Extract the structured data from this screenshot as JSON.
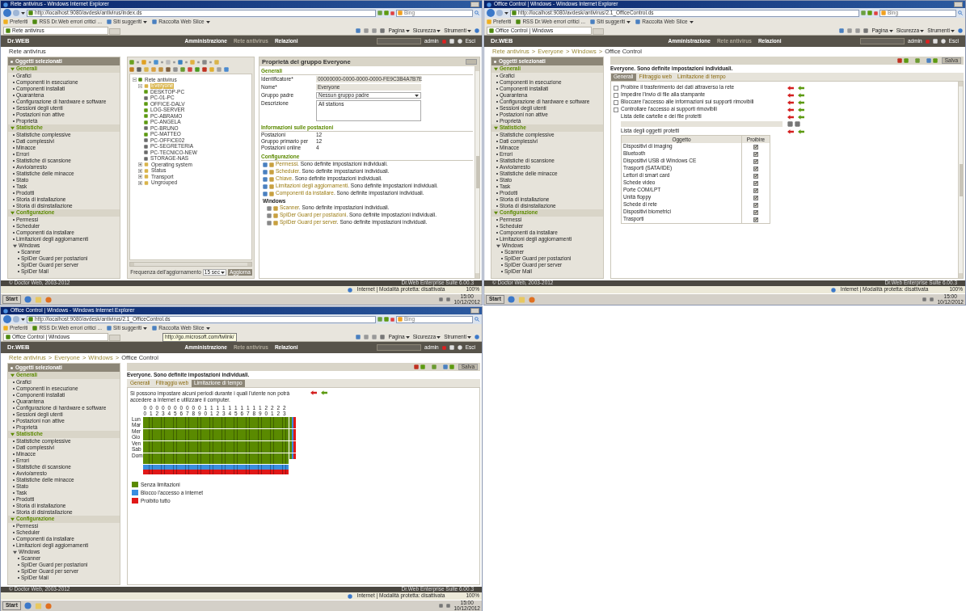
{
  "windows": [
    {
      "kind": "group_properties",
      "title": "Rete antivirus - Windows Internet Explorer",
      "url": "http://localhost:9080/avdesk/antivirus/index.ds",
      "search": "Bing",
      "favorites": [
        "Preferiti",
        "RSS Dr.Web errori critici ...",
        "Siti suggeriti",
        "Raccolta Web Slice"
      ],
      "tab": "Rete antivirus",
      "commands": [
        "Pagina",
        "Sicurezza",
        "Strumenti"
      ],
      "app": {
        "logo": "Dr.WEB",
        "nav": [
          {
            "label": "Amministrazione",
            "selected": false
          },
          {
            "label": "Rete antivirus",
            "selected": true
          },
          {
            "label": "Relazioni",
            "selected": false
          }
        ],
        "user": "admin",
        "logout": "Esci"
      },
      "breadcrumb": [
        "Rete antivirus"
      ],
      "sidebar": {
        "header": "Oggetti selezionati",
        "sections": [
          {
            "title": "Generali",
            "expanded": true,
            "items": [
              {
                "label": "Grafici"
              },
              {
                "label": "Componenti in esecuzione"
              },
              {
                "label": "Componenti installati"
              },
              {
                "label": "Quarantena"
              },
              {
                "label": "Configurazione di hardware e software"
              },
              {
                "label": "Sessioni degli utenti"
              },
              {
                "label": "Postazioni non attive"
              },
              {
                "label": "Proprietà"
              }
            ]
          },
          {
            "title": "Statistiche",
            "expanded": true,
            "items": [
              {
                "label": "Statistiche complessive"
              },
              {
                "label": "Dati complessivi"
              },
              {
                "label": "Minacce"
              },
              {
                "label": "Errori"
              },
              {
                "label": "Statistiche di scansione"
              },
              {
                "label": "Avvio/arresto"
              },
              {
                "label": "Statistiche delle minacce"
              },
              {
                "label": "Stato"
              },
              {
                "label": "Task"
              },
              {
                "label": "Prodotti"
              },
              {
                "label": "Storia di installazione"
              },
              {
                "label": "Storia di disinstallazione"
              }
            ]
          },
          {
            "title": "Configurazione",
            "expanded": true,
            "items": [
              {
                "label": "Permessi"
              },
              {
                "label": "Scheduler"
              },
              {
                "label": "Componenti da installare"
              },
              {
                "label": "Limitazioni degli aggiornamenti"
              },
              {
                "label": "Windows",
                "children": [
                  {
                    "label": "Scanner"
                  },
                  {
                    "label": "SpIDer Guard per postazioni"
                  },
                  {
                    "label": "SpIDer Guard per server"
                  },
                  {
                    "label": "SpIDer Mail"
                  }
                ]
              }
            ]
          }
        ]
      },
      "tree": {
        "nodes": [
          {
            "label": "Rete antivirus",
            "kind": "root",
            "expanded": true,
            "children": [
              {
                "label": "Everyone",
                "kind": "group",
                "expanded": true,
                "selected": true,
                "children": [
                  {
                    "label": "DESKTOP-PC",
                    "kind": "station",
                    "online": true
                  },
                  {
                    "label": "PC-01-PC",
                    "kind": "station",
                    "online": false
                  },
                  {
                    "label": "OFFICE-DALV",
                    "kind": "station",
                    "online": true
                  },
                  {
                    "label": "LOG-SERVER",
                    "kind": "station",
                    "online": true
                  },
                  {
                    "label": "PC-ABRAMO",
                    "kind": "station",
                    "online": true
                  },
                  {
                    "label": "PC-ANGELA",
                    "kind": "station",
                    "online": true
                  },
                  {
                    "label": "PC-BRUNO",
                    "kind": "station",
                    "online": false
                  },
                  {
                    "label": "PC-MATTEO",
                    "kind": "station",
                    "online": true
                  },
                  {
                    "label": "PC-OFFICE02",
                    "kind": "station",
                    "online": false
                  },
                  {
                    "label": "PC-SEGRETERIA",
                    "kind": "station",
                    "online": false
                  },
                  {
                    "label": "PC-TECNICO-NEW",
                    "kind": "station",
                    "online": false
                  },
                  {
                    "label": "STORAGE-NAS",
                    "kind": "station",
                    "online": false
                  }
                ]
              },
              {
                "label": "Operating system",
                "kind": "group",
                "expanded": false,
                "selected": false
              },
              {
                "label": "Status",
                "kind": "group",
                "expanded": false,
                "selected": false
              },
              {
                "label": "Transport",
                "kind": "group",
                "expanded": false,
                "selected": false
              },
              {
                "label": "Ungrouped",
                "kind": "group",
                "expanded": false,
                "selected": false
              }
            ]
          }
        ],
        "refresh_label": "Frequenza dell'aggiornamento",
        "refresh_value": "15 sec",
        "refresh_button": "Aggiorna"
      },
      "properties": {
        "title": "Proprietà del gruppo Everyone",
        "sections": [
          {
            "kind": "fields",
            "title": "Generali",
            "fields": [
              {
                "label": "Identificatore*",
                "value": "00000000-0000-0000-0000-FE9C3B4A7B7E",
                "kind": "readonly"
              },
              {
                "label": "Nome*",
                "value": "Everyone",
                "kind": "readonly"
              },
              {
                "label": "Gruppo padre",
                "value": "Nessun gruppo padre",
                "kind": "select"
              },
              {
                "label": "Descrizione",
                "value": "All stations",
                "kind": "textarea"
              }
            ]
          },
          {
            "kind": "info",
            "title": "Informazioni sulle postazioni",
            "rows": [
              {
                "label": "Postazioni",
                "value": "12"
              },
              {
                "label": "Gruppo primario per",
                "value": "12"
              },
              {
                "label": "Postazioni online",
                "value": "4"
              }
            ]
          },
          {
            "kind": "config",
            "title": "Configurazione",
            "items": [
              {
                "link": "Permessi",
                "note": ". Sono definite impostazioni individuali."
              },
              {
                "link": "Scheduler",
                "note": ". Sono definite impostazioni individuali."
              },
              {
                "link": "Chiave",
                "note": ". Sono definite impostazioni individuali."
              },
              {
                "link": "Limitazioni degli aggiornamenti",
                "note": ". Sono definite impostazioni individuali."
              },
              {
                "link": "Componenti da installare",
                "note": ". Sono definite impostazioni individuali."
              }
            ],
            "subtitle": "Windows",
            "subitems": [
              {
                "link": "Scanner",
                "note": ". Sono definite impostazioni individuali."
              },
              {
                "link": "SpIDer Guard per postazioni",
                "note": ". Sono definite impostazioni individuali."
              },
              {
                "link": "SpIDer Guard per server",
                "note": ". Sono definite impostazioni individuali."
              }
            ]
          }
        ]
      },
      "footer": {
        "left": "© Doctor Web, 2003-2012",
        "right": "Dr.Web Enterprise Suite 6.00.3"
      },
      "status": {
        "zone": "Internet | Modalità protetta: disattivata",
        "zoom": "100%"
      },
      "taskbar": {
        "start": "Start",
        "time": "15:00",
        "date": "10/12/2012"
      }
    },
    {
      "kind": "office_general",
      "title": "Office Control | Windows - Windows Internet Explorer",
      "url": "http://localhost:9080/avdesk/antivirus/2.1_OfficeControl.ds",
      "search": "Bing",
      "favorites": [
        "Preferiti",
        "RSS Dr.Web errori critici ...",
        "Siti suggeriti",
        "Raccolta Web Slice"
      ],
      "tab": "Office Control | Windows",
      "commands": [
        "Pagina",
        "Sicurezza",
        "Strumenti"
      ],
      "app": {
        "logo": "Dr.WEB",
        "nav": [
          {
            "label": "Amministrazione",
            "selected": false
          },
          {
            "label": "Rete antivirus",
            "selected": true
          },
          {
            "label": "Relazioni",
            "selected": false
          }
        ],
        "user": "admin",
        "logout": "Esci"
      },
      "breadcrumb": [
        "Rete antivirus",
        "Everyone",
        "Windows",
        "Office Control"
      ],
      "separator": ">",
      "sidebar": {
        "header": "Oggetti selezionati",
        "sections": [
          {
            "title": "Generali",
            "expanded": true,
            "items": [
              {
                "label": "Grafici"
              },
              {
                "label": "Componenti in esecuzione"
              },
              {
                "label": "Componenti installati"
              },
              {
                "label": "Quarantena"
              },
              {
                "label": "Configurazione di hardware e software"
              },
              {
                "label": "Sessioni degli utenti"
              },
              {
                "label": "Postazioni non attive"
              },
              {
                "label": "Proprietà"
              }
            ]
          },
          {
            "title": "Statistiche",
            "expanded": true,
            "items": [
              {
                "label": "Statistiche complessive"
              },
              {
                "label": "Dati complessivi"
              },
              {
                "label": "Minacce"
              },
              {
                "label": "Errori"
              },
              {
                "label": "Statistiche di scansione"
              },
              {
                "label": "Avvio/arresto"
              },
              {
                "label": "Statistiche delle minacce"
              },
              {
                "label": "Stato"
              },
              {
                "label": "Task"
              },
              {
                "label": "Prodotti"
              },
              {
                "label": "Storia di installazione"
              },
              {
                "label": "Storia di disinstallazione"
              }
            ]
          },
          {
            "title": "Configurazione",
            "expanded": true,
            "items": [
              {
                "label": "Permessi"
              },
              {
                "label": "Scheduler"
              },
              {
                "label": "Componenti da installare"
              },
              {
                "label": "Limitazioni degli aggiornamenti"
              },
              {
                "label": "Windows",
                "children": [
                  {
                    "label": "Scanner"
                  },
                  {
                    "label": "SpIDer Guard per postazioni"
                  },
                  {
                    "label": "SpIDer Guard per server"
                  },
                  {
                    "label": "SpIDer Mail"
                  }
                ]
              }
            ]
          }
        ]
      },
      "panel": {
        "save": "Salva",
        "heading": "Everyone. Sono definite impostazioni individuali.",
        "tabs": [
          {
            "label": "Generali",
            "selected": true
          },
          {
            "label": "Filtraggio web",
            "selected": false
          },
          {
            "label": "Limitazione di tempo",
            "selected": false
          }
        ],
        "settings": [
          {
            "kind": "checkbox",
            "label": "Proibire il trasferimento dei dati attraverso la rete",
            "checked": false
          },
          {
            "kind": "checkbox",
            "label": "Impedire l'invio di file alla stampante",
            "checked": false
          },
          {
            "kind": "checkbox",
            "label": "Bloccare l'accesso alle informazioni sui supporti rimovibili",
            "checked": false
          },
          {
            "kind": "checkbox",
            "label": "Controllare l'accesso ai supporti rimovibili",
            "checked": false
          },
          {
            "kind": "label",
            "label": "Lista delle cartelle e dei file protetti"
          },
          {
            "kind": "path"
          },
          {
            "kind": "label",
            "label": "Lista degli oggetti protetti"
          }
        ],
        "table": {
          "columns": [
            "Oggetto",
            "Proibire"
          ],
          "rows": [
            {
              "label": "Dispositivi di imaging",
              "checked": true
            },
            {
              "label": "Bluetooth",
              "checked": true
            },
            {
              "label": "Dispositivi USB di Windows CE",
              "checked": true
            },
            {
              "label": "Trasporti (SATA/IDE)",
              "checked": true
            },
            {
              "label": "Lettori di smart card",
              "checked": true
            },
            {
              "label": "Schede video",
              "checked": true
            },
            {
              "label": "Porte COM/LPT",
              "checked": true
            },
            {
              "label": "Unità floppy",
              "checked": true
            },
            {
              "label": "Schede di rete",
              "checked": true
            },
            {
              "label": "Dispositivi biometrici",
              "checked": true
            },
            {
              "label": "Trasporti",
              "checked": true
            }
          ]
        }
      },
      "footer": {
        "left": "© Doctor Web, 2003-2012",
        "right": "Dr.Web Enterprise Suite 6.00.3"
      },
      "status": {
        "zone": "Internet | Modalità protetta: disattivata",
        "zoom": "100%"
      },
      "taskbar": {
        "start": "Start",
        "time": "15:00",
        "date": "10/12/2012"
      }
    },
    {
      "kind": "office_time",
      "title": "Office Control | Windows - Windows Internet Explorer",
      "url": "http://localhost:9080/avdesk/antivirus/2.1_OfficeControl.ds",
      "search": "Bing",
      "favorites": [
        "Preferiti",
        "RSS Dr.Web errori critici ...",
        "Siti suggeriti",
        "Raccolta Web Slice"
      ],
      "tooltip": "http://go.microsoft.com/fwlink/",
      "tab": "Office Control | Windows",
      "commands": [
        "Pagina",
        "Sicurezza",
        "Strumenti"
      ],
      "app": {
        "logo": "Dr.WEB",
        "nav": [
          {
            "label": "Amministrazione",
            "selected": false
          },
          {
            "label": "Rete antivirus",
            "selected": true
          },
          {
            "label": "Relazioni",
            "selected": false
          }
        ],
        "user": "admin",
        "logout": "Esci"
      },
      "breadcrumb": [
        "Rete antivirus",
        "Everyone",
        "Windows",
        "Office Control"
      ],
      "separator": ">",
      "sidebar": {
        "header": "Oggetti selezionati",
        "sections": [
          {
            "title": "Generali",
            "expanded": true,
            "items": [
              {
                "label": "Grafici"
              },
              {
                "label": "Componenti in esecuzione"
              },
              {
                "label": "Componenti installati"
              },
              {
                "label": "Quarantena"
              },
              {
                "label": "Configurazione di hardware e software"
              },
              {
                "label": "Sessioni degli utenti"
              },
              {
                "label": "Postazioni non attive"
              },
              {
                "label": "Proprietà"
              }
            ]
          },
          {
            "title": "Statistiche",
            "expanded": true,
            "items": [
              {
                "label": "Statistiche complessive"
              },
              {
                "label": "Dati complessivi"
              },
              {
                "label": "Minacce"
              },
              {
                "label": "Errori"
              },
              {
                "label": "Statistiche di scansione"
              },
              {
                "label": "Avvio/arresto"
              },
              {
                "label": "Statistiche delle minacce"
              },
              {
                "label": "Stato"
              },
              {
                "label": "Task"
              },
              {
                "label": "Prodotti"
              },
              {
                "label": "Storia di installazione"
              },
              {
                "label": "Storia di disinstallazione"
              }
            ]
          },
          {
            "title": "Configurazione",
            "expanded": true,
            "items": [
              {
                "label": "Permessi"
              },
              {
                "label": "Scheduler"
              },
              {
                "label": "Componenti da installare"
              },
              {
                "label": "Limitazioni degli aggiornamenti"
              },
              {
                "label": "Windows",
                "children": [
                  {
                    "label": "Scanner"
                  },
                  {
                    "label": "SpIDer Guard per postazioni"
                  },
                  {
                    "label": "SpIDer Guard per server"
                  },
                  {
                    "label": "SpIDer Mail"
                  }
                ]
              }
            ]
          }
        ]
      },
      "panel": {
        "save": "Salva",
        "heading": "Everyone. Sono definite impostazioni individuali.",
        "tabs": [
          {
            "label": "Generali",
            "selected": false
          },
          {
            "label": "Filtraggio web",
            "selected": false
          },
          {
            "label": "Limitazione di tempo",
            "selected": true
          }
        ],
        "schedule": {
          "description": "Si possono impostare alcuni periodi durante i quali l'utente non potrà accedere a Internet e utilizzare il computer.",
          "hours": [
            "00",
            "01",
            "02",
            "03",
            "04",
            "05",
            "06",
            "07",
            "08",
            "09",
            "10",
            "11",
            "12",
            "13",
            "14",
            "15",
            "16",
            "17",
            "18",
            "19",
            "20",
            "21",
            "22",
            "23"
          ],
          "days": [
            {
              "label": "Lun",
              "internet_blocked": false,
              "all_blocked": false
            },
            {
              "label": "Mar",
              "internet_blocked": false,
              "all_blocked": false
            },
            {
              "label": "Mer",
              "internet_blocked": false,
              "all_blocked": false
            },
            {
              "label": "Gio",
              "internet_blocked": false,
              "all_blocked": false
            },
            {
              "label": "Ven",
              "internet_blocked": false,
              "all_blocked": false
            },
            {
              "label": "Sab",
              "internet_blocked": false,
              "all_blocked": false
            },
            {
              "label": "Dom",
              "internet_blocked": false,
              "all_blocked": false
            }
          ],
          "legend": [
            {
              "label": "Senza limitazioni",
              "color": "#5a8a00"
            },
            {
              "label": "Blocco l'accesso a Internet",
              "color": "#3a8ee0"
            },
            {
              "label": "Proibito tutto",
              "color": "#e01818"
            }
          ]
        }
      },
      "footer": {
        "left": "© Doctor Web, 2003-2012",
        "right": "Dr.Web Enterprise Suite 6.00.3"
      },
      "status": {
        "zone": "Internet | Modalità protetta: disattivata",
        "zoom": "100%"
      },
      "taskbar": {
        "start": "Start",
        "time": "15:00",
        "date": "10/12/2012"
      }
    }
  ]
}
